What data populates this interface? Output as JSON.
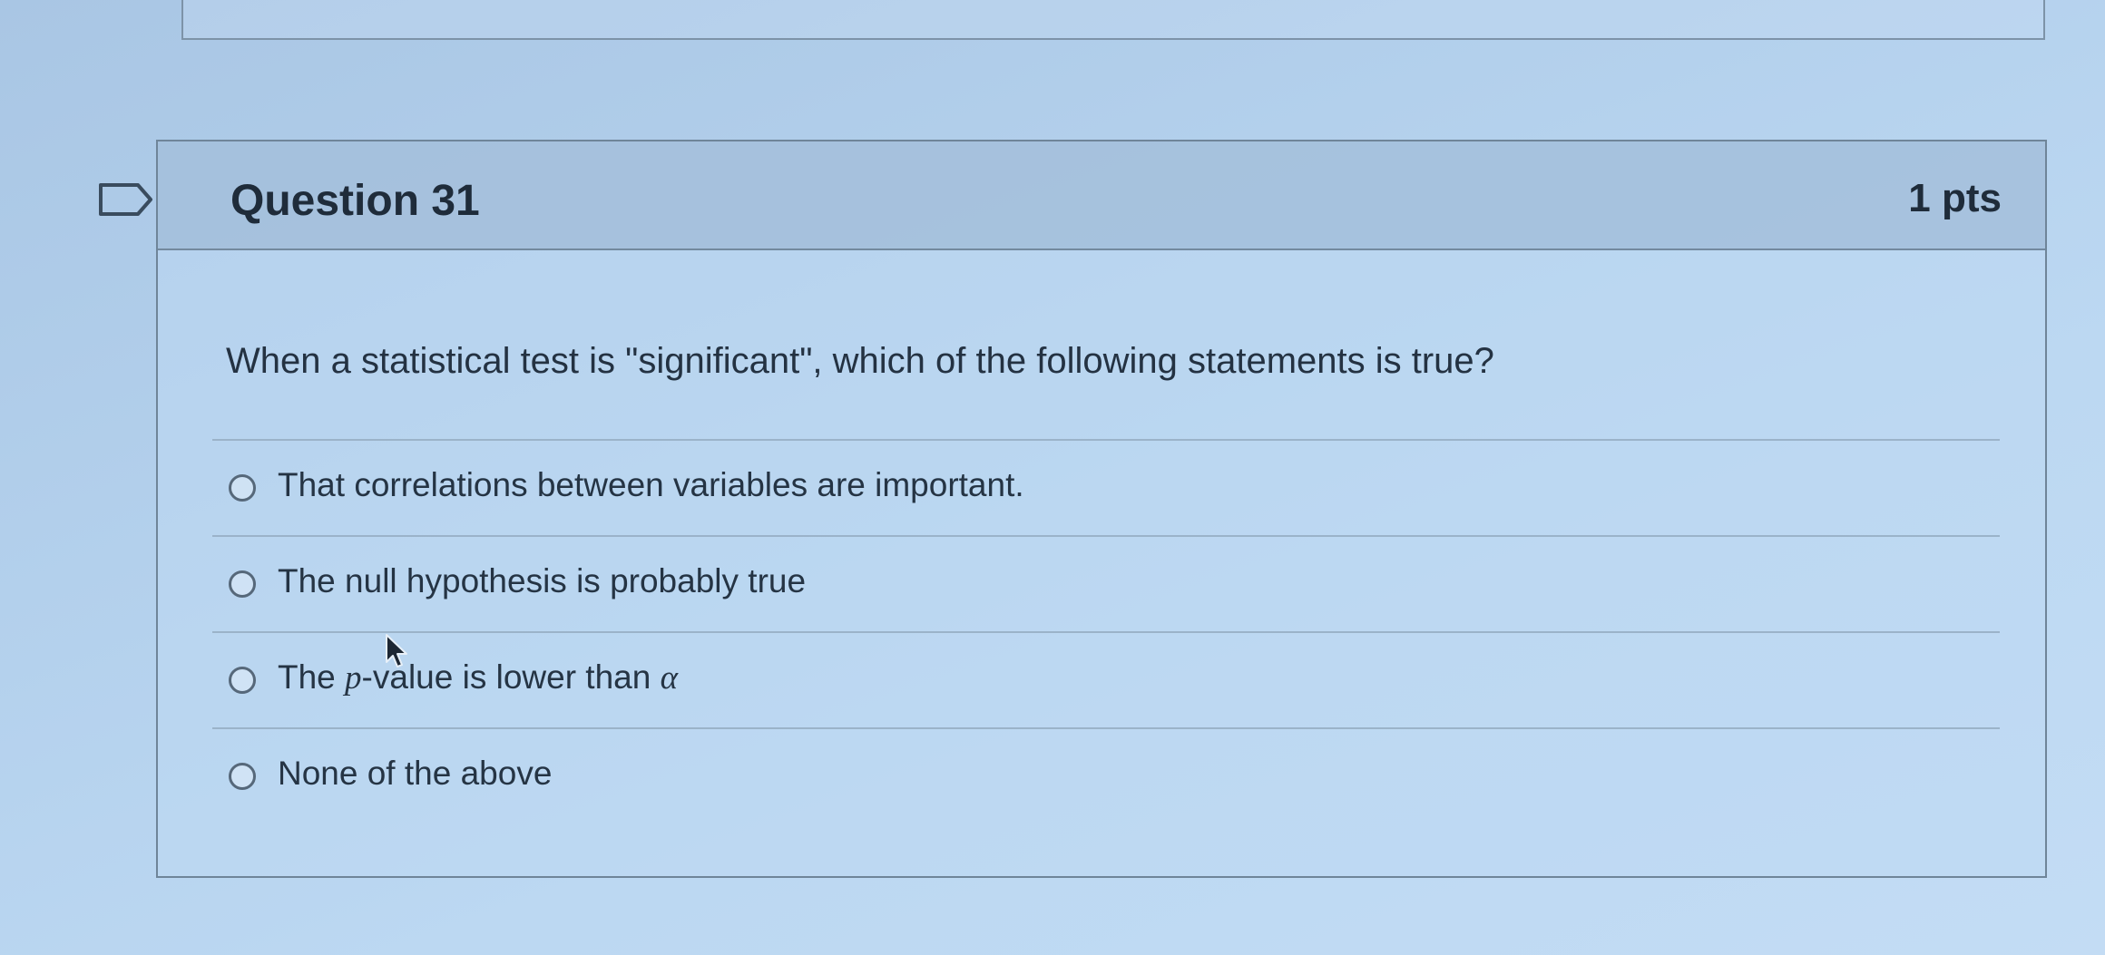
{
  "question": {
    "title": "Question 31",
    "points": "1 pts",
    "text": "When a statistical test is \"significant\", which of the following statements is true?"
  },
  "answers": [
    {
      "label": "That correlations between variables are important."
    },
    {
      "label": "The null hypothesis is probably true"
    },
    {
      "label_prefix": "The ",
      "label_italic_1": "p",
      "label_middle": "-value is lower than ",
      "label_italic_2": "α"
    },
    {
      "label": "None of the above"
    }
  ],
  "icons": {
    "flag": "flag-icon",
    "cursor": "cursor-icon"
  },
  "colors": {
    "background": "#b3d0ec",
    "header": "#9eb9d6",
    "border": "#6f8599",
    "text": "#243242"
  }
}
